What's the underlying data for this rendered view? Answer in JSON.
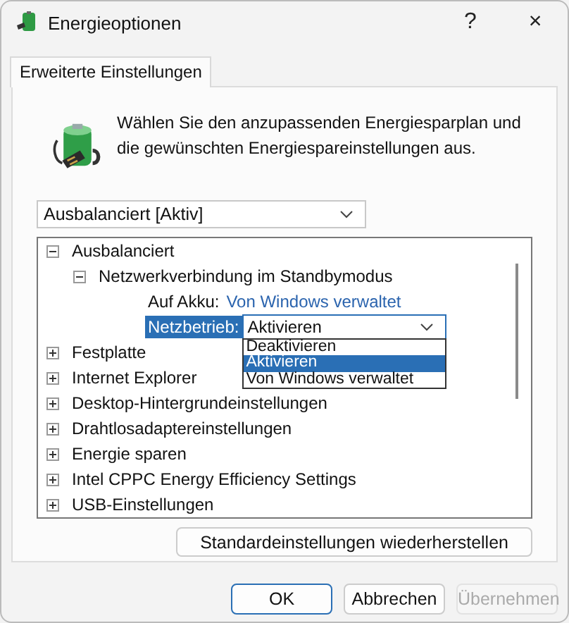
{
  "window": {
    "title": "Energieoptionen",
    "help": "?",
    "close": "×"
  },
  "tabs": [
    {
      "label": "Erweiterte Einstellungen",
      "selected": true
    }
  ],
  "description": "Wählen Sie den anzupassenden Energiesparplan und die gewünschten Energiespareinstellungen aus.",
  "plan_select": {
    "value": "Ausbalanciert [Aktiv]"
  },
  "tree": [
    {
      "kind": "group",
      "label": "Ausbalanciert",
      "expanded": true,
      "children": [
        {
          "kind": "group",
          "label": "Netzwerkverbindung im Standbymodus",
          "expanded": true,
          "children": [
            {
              "kind": "setting",
              "label": "Auf Akku:",
              "value": "Von Windows verwaltet",
              "editing": false
            },
            {
              "kind": "setting",
              "label": "Netzbetrieb:",
              "value": "Aktivieren",
              "editing": true,
              "options": [
                {
                  "label": "Deaktivieren",
                  "selected": false
                },
                {
                  "label": "Aktivieren",
                  "selected": true
                },
                {
                  "label": "Von Windows verwaltet",
                  "selected": false
                }
              ]
            }
          ]
        }
      ]
    },
    {
      "kind": "group",
      "label": "Festplatte",
      "expanded": false
    },
    {
      "kind": "group",
      "label": "Internet Explorer",
      "expanded": false
    },
    {
      "kind": "group",
      "label": "Desktop-Hintergrundeinstellungen",
      "expanded": false
    },
    {
      "kind": "group",
      "label": "Drahtlosadaptereinstellungen",
      "expanded": false
    },
    {
      "kind": "group",
      "label": "Energie sparen",
      "expanded": false
    },
    {
      "kind": "group",
      "label": "Intel CPPC Energy Efficiency Settings",
      "expanded": false
    },
    {
      "kind": "group",
      "label": "USB-Einstellungen",
      "expanded": false
    }
  ],
  "restore_button": "Standardeinstellungen wiederherstellen",
  "buttons": [
    {
      "label": "OK",
      "default": true,
      "disabled": false
    },
    {
      "label": "Abbrechen",
      "default": false,
      "disabled": false
    },
    {
      "label": "Übernehmen",
      "default": false,
      "disabled": true
    }
  ]
}
